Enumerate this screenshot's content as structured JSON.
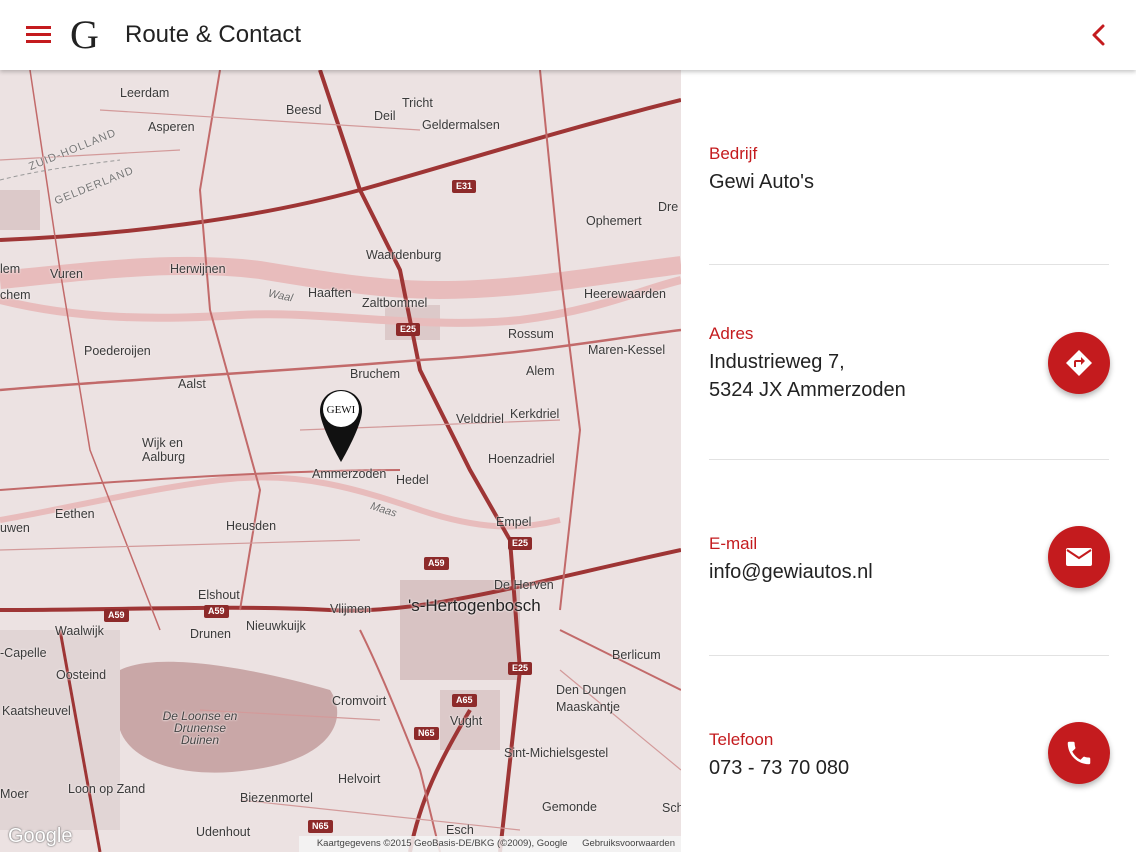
{
  "app": {
    "title": "Route & Contact",
    "logo_letter": "G",
    "accent_color": "#c41b1e",
    "menu_icon": "hamburger-menu-icon",
    "back_icon": "chevron-left-icon"
  },
  "map": {
    "marker_text": "GEWI",
    "google_logo": "Google",
    "attribution": "Kaartgegevens ©2015 GeoBasis-DE/BKG (©2009), Google",
    "terms_link": "Gebruiksvoorwaarden",
    "places": {
      "leerdam": "Leerdam",
      "beesd": "Beesd",
      "tricht": "Tricht",
      "deil": "Deil",
      "asperen": "Asperen",
      "geldermalsen": "Geldermalsen",
      "zuid_holland": "ZUID-HOLLAND",
      "gelderland": "GELDERLAND",
      "ophemert": "Ophemert",
      "dre": "Dre",
      "waardenburg": "Waardenburg",
      "vuren": "Vuren",
      "herwijnen": "Herwijnen",
      "lem": "lem",
      "chem": "chem",
      "waal": "Waal",
      "haaften": "Haaften",
      "zaltbommel": "Zaltbommel",
      "heerewaarden": "Heerewaarden",
      "rossum": "Rossum",
      "maren_kessel": "Maren-Kessel",
      "poederoijen": "Poederoijen",
      "aalst": "Aalst",
      "bruchem": "Bruchem",
      "alem": "Alem",
      "wijk_en_aalburg": "Wijk en Aalburg",
      "velddriel": "Velddriel",
      "kerkdriel": "Kerkdriel",
      "ammerzoden": "Ammerzoden",
      "hedel": "Hedel",
      "hoenzadriel": "Hoenzadriel",
      "eethen": "Eethen",
      "uwen": "uwen",
      "heusden": "Heusden",
      "maas": "Maas",
      "empel": "Empel",
      "elshout": "Elshout",
      "de_herven": "De Herven",
      "vlijmen": "Vlijmen",
      "s_hertogenbosch": "'s-Hertogenbosch",
      "waalwijk": "Waalwijk",
      "drunen": "Drunen",
      "nieuwkuijk": "Nieuwkuijk",
      "capelle": "-Capelle",
      "berlicum": "Berlicum",
      "oosteind": "Oosteind",
      "cromvoirt": "Cromvoirt",
      "den_dungen": "Den Dungen",
      "maaskantje": "Maaskantje",
      "kaatsheuvel": "Kaatsheuvel",
      "vught": "Vught",
      "park": "De Loonse en Drunense Duinen",
      "sint_michielsgestel": "Sint-Michielsgestel",
      "helvoirt": "Helvoirt",
      "moer": "Moer",
      "loon_op_zand": "Loon op Zand",
      "biezenmortel": "Biezenmortel",
      "gemonde": "Gemonde",
      "sch": "Sch",
      "udenhout": "Udenhout",
      "esch": "Esch"
    },
    "shields": {
      "e31": "E31",
      "e25_a": "E25",
      "e25_b": "E25",
      "e25_c": "E25",
      "a59_a": "A59",
      "a59_b": "A59",
      "a59_c": "A59",
      "a65": "A65",
      "n65_a": "N65",
      "n65_b": "N65"
    }
  },
  "contact": {
    "company": {
      "label": "Bedrijf",
      "value": "Gewi Auto's"
    },
    "address": {
      "label": "Adres",
      "line1": "Industrieweg 7,",
      "line2": "5324 JX Ammerzoden",
      "icon": "directions-icon"
    },
    "email": {
      "label": "E-mail",
      "value": "info@gewiautos.nl",
      "icon": "email-icon"
    },
    "phone": {
      "label": "Telefoon",
      "value": "073 - 73 70 080",
      "icon": "phone-icon"
    }
  }
}
